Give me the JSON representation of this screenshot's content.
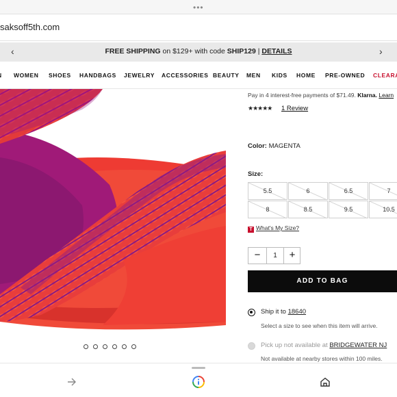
{
  "browser": {
    "url": "saksoff5th.com"
  },
  "promo": {
    "bold_text": "FREE SHIPPING",
    "text": " on $129+ with code ",
    "code": "SHIP129",
    "separator": " | ",
    "details_label": "DETAILS",
    "prev_icon": "chevron-left-icon",
    "next_icon": "chevron-right-icon"
  },
  "nav": {
    "items": [
      {
        "label": "N"
      },
      {
        "label": "WOMEN"
      },
      {
        "label": "SHOES"
      },
      {
        "label": "HANDBAGS"
      },
      {
        "label": "JEWELRY"
      },
      {
        "label": "ACCESSORIES"
      },
      {
        "label": "BEAUTY"
      },
      {
        "label": "MEN"
      },
      {
        "label": "KIDS"
      },
      {
        "label": "HOME"
      },
      {
        "label": "PRE-OWNED"
      },
      {
        "label": "CLEARA"
      }
    ],
    "clearance_color": "#c8102e"
  },
  "gallery": {
    "dot_count": 6
  },
  "product": {
    "klarna_text": "Pay in 4 interest-free payments of $71.49.",
    "klarna_brand": "Klarna.",
    "klarna_link": "Learn",
    "rating": 5,
    "stars_text": "★★★★★",
    "reviews_label": "1 Review",
    "color_label": "Color:",
    "color_value": "MAGENTA",
    "size_label": "Size:",
    "sizes": [
      "5.5",
      "6",
      "6.5",
      "7",
      "8",
      "8.5",
      "9.5",
      "10.5"
    ],
    "whats_my_size_icon": "T",
    "whats_my_size_label": "What's My Size?",
    "quantity": "1",
    "add_to_bag_label": "ADD TO BAG",
    "ship_label": "Ship it to",
    "ship_zip": "18640",
    "ship_note": "Select a size to see when this item will arrive.",
    "pickup_label": "Pick up not available at",
    "pickup_store": "BRIDGEWATER NJ",
    "pickup_note": "Not available at nearby stores within 100 miles."
  },
  "bottom_bar": {
    "icons": [
      "forward-arrow-icon",
      "google-lens-icon",
      "home-icon"
    ]
  },
  "colors": {
    "accent": "#c8102e",
    "button_bg": "#0c0c0c"
  }
}
